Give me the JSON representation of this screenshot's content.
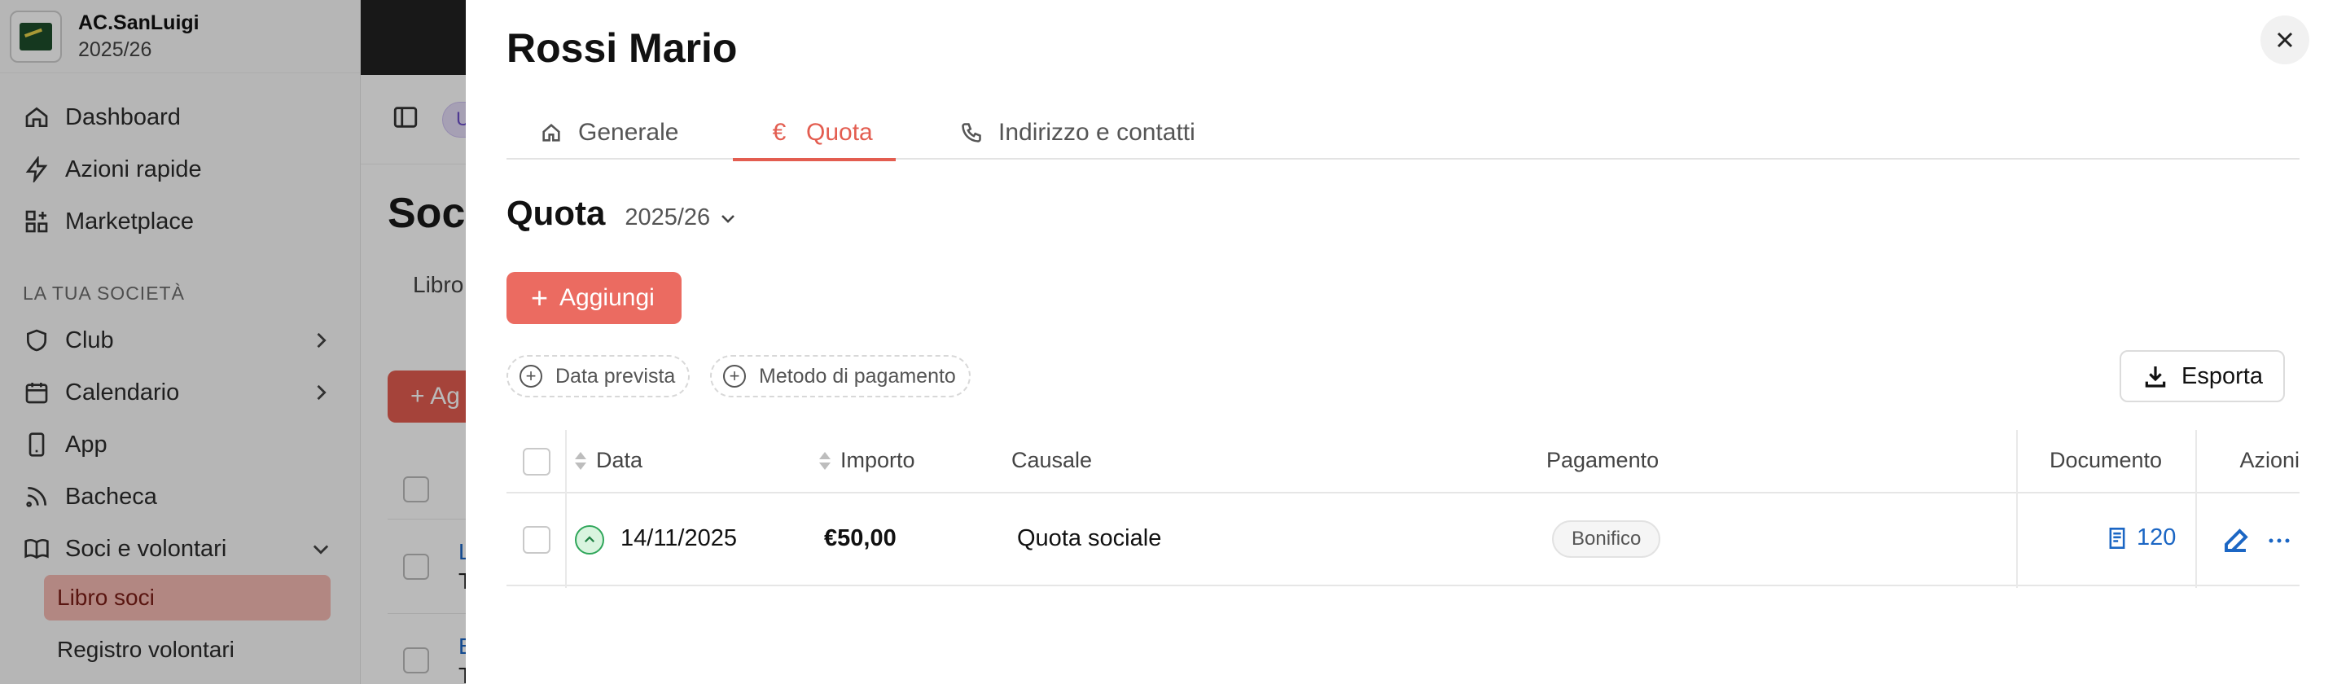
{
  "background": {
    "brand": {
      "name": "AC.SanLuigi",
      "season": "2025/26"
    },
    "nav": [
      {
        "label": "Dashboard",
        "icon": "home-icon"
      },
      {
        "label": "Azioni rapide",
        "icon": "lightning-icon"
      },
      {
        "label": "Marketplace",
        "icon": "apps-icon"
      }
    ],
    "section_title": "LA TUA SOCIETÀ",
    "society_nav": [
      {
        "label": "Club",
        "icon": "shield-icon",
        "chevron": "right"
      },
      {
        "label": "Calendario",
        "icon": "calendar-icon",
        "chevron": "right"
      },
      {
        "label": "App",
        "icon": "phone-icon"
      },
      {
        "label": "Bacheca",
        "icon": "rss-icon"
      },
      {
        "label": "Soci e volontari",
        "icon": "book-icon",
        "chevron": "down"
      }
    ],
    "sub_items": [
      {
        "label": "Libro soci",
        "active": true
      },
      {
        "label": "Registro volontari",
        "active": false
      }
    ],
    "main": {
      "pill": "U",
      "title": "Soci",
      "tab": "Libro",
      "add_label": "+ Ag",
      "row_letters": [
        "L",
        "T",
        "E",
        "T"
      ]
    }
  },
  "drawer": {
    "title": "Rossi Mario",
    "close_icon": "close-icon",
    "tabs": [
      {
        "label": "Generale",
        "icon": "home-icon",
        "active": false
      },
      {
        "label": "Quota",
        "icon": "euro-icon",
        "glyph": "€",
        "active": true
      },
      {
        "label": "Indirizzo e contatti",
        "icon": "phone-icon",
        "active": false
      }
    ],
    "section_title": "Quota",
    "season_select": "2025/26",
    "add_button": "Aggiungi",
    "filters": [
      "Data prevista",
      "Metodo di pagamento"
    ],
    "export_button": "Esporta",
    "table": {
      "columns": [
        "Data",
        "Importo",
        "Causale",
        "Pagamento",
        "Documento",
        "Azioni"
      ],
      "rows": [
        {
          "data": "14/11/2025",
          "importo": "€50,00",
          "causale": "Quota sociale",
          "pagamento": "Bonifico",
          "documento": "120"
        }
      ]
    },
    "colors": {
      "accent": "#e35d50",
      "link": "#1b66c4",
      "success": "#2fa65a"
    }
  }
}
